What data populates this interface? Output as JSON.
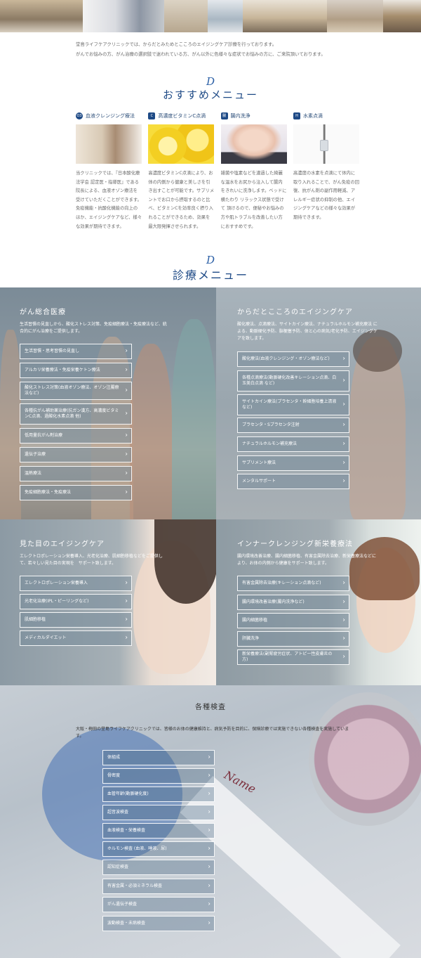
{
  "intro": {
    "line1": "堂島ライフケアクリニックでは、からだとみためとこころのエイジングケア診療を行っております。",
    "line2": "がんでお悩みの方、がん治療の選択肢で迷われている方、がん以外に色様々な症状でお悩みの方に、ご来院頂いております。"
  },
  "recommend": {
    "logo": "D",
    "title": "おすすめメニュー",
    "items": [
      {
        "icon": "O3",
        "label": "血液クレンジング療法",
        "text": "当クリニックでは、『日本酸化療法学会 認定医・指導医』である院長による、血液オゾン療法を受けていただくことができます。免疫機能・抗酸化機能の向上のほか、エイジングケアなど、様々な効果が期待できます。"
      },
      {
        "icon": "C",
        "label": "高濃度ビタミンC点滴",
        "text": "高濃度ビタミンC点滴により、お体の内側から健康と美しさを引き出すことが可能です。サプリメントでお口から摂取するのと比べ、ビタミンCを効率良く摂り入れることができるため、効果を最大限発揮させられます。"
      },
      {
        "icon": "腸",
        "label": "腸内洗浄",
        "text": "雑菌や塩素などを濾過した綺麗な温水をお尻から注入して腸内をきれいに洗浄します。ベッドに横たわり リラックス状態で受けて 頂けるので、便秘やお悩みの方や肌トラブルを改善したい方におすすめです。"
      },
      {
        "icon": "H",
        "label": "水素点滴",
        "text": "高濃度の水素を点滴にて体内に取り入れることで、がん免疫の回復、抗がん剤の副作用軽減、アレルギー症状の抑制の他、エイジングケアなどの様々な効果が期待できます。"
      }
    ]
  },
  "clinic": {
    "logo": "D",
    "title": "診療メニュー"
  },
  "cancer": {
    "title": "がん総合医療",
    "desc": "生活習慣の見直しから、酸化ストレス対策、免疫細胞療法・免疫療法など、統合的にがん治療をご提供します。",
    "buttons": [
      "生活習慣・思考習慣の見直し",
      "アルカリ栄養療法・免疫栄養ケトン療法",
      "酸化ストレス対策(血液オゾン療法、オゾン注腸療法など)",
      "各種抗がん補助薬治療(抗ガン漢方、高濃度ビタミンC点滴、過酸化水素点滴 他)",
      "低用量抗がん剤治療",
      "遺伝子治療",
      "温熱療法",
      "免疫細胞療法・免疫療法"
    ]
  },
  "body_mind": {
    "title": "からだとこころのエイジングケア",
    "desc": "酸化療法、点滴療法、サイトカイン療法、ナチュラルホルモン補充療法 による、動脈硬化予防、脳梗塞予防、体と心の病気/老化予防、エイジングケアを致します。",
    "buttons": [
      "酸化療法(血液クレンジング・オゾン療法など)",
      "各種点滴療法(動脈硬化改善キレーション点滴、白玉美白点滴 など)",
      "サイトカイン療法(プラセンタ・幹細胞培養上清液 など)",
      "プラセンタ・Sプラセンタ注射",
      "ナチュラルホルモン補充療法",
      "サプリメント療法",
      "メンタルサポート"
    ]
  },
  "looks": {
    "title": "見た目のエイジングケア",
    "desc": "エレクトロポレーション栄養導入、光老化治療、肌細胞移植などをご提供して、若々しい見た目の実現を　サポート致します。",
    "buttons": [
      "エレクトロポレーション栄養導入",
      "光老化治療(IPL・ピーリングなど)",
      "肌細胞移植",
      "メディカルダイエット"
    ]
  },
  "inner": {
    "title": "インナークレンジング新栄養療法",
    "desc": "腸内環境改善治療、腸内細菌移植、有害金属除去治療、新栄養療法などにより、お体の内側から健康をサポート致します。",
    "buttons": [
      "有害金属除去治療(キレーション点滴など)",
      "腸内環境改善治療(腸内洗浄など)",
      "腸内細菌移植",
      "肝臓洗浄",
      "新栄養療法(副腎疲労症状、アトピー性皮膚炎の方)"
    ]
  },
  "tests": {
    "title": "各種検査",
    "desc": "大阪・梅田の堂島ライフケアクリニックでは、皆様のお体の健康維持と、病気予防を目的に、保険診療では実施できない各種検査を実施しています。",
    "buttons": [
      "体組成",
      "骨密度",
      "血管年齢(動脈硬化度)",
      "超音波検査",
      "血液検査・栄養検査",
      "ホルモン検査 (血液、唾液、尿)",
      "認知症検査",
      "有害金属・必須ミネラル検査",
      "がん遺伝子検査",
      "波動検査・未病検査"
    ],
    "tube_label": "Name"
  }
}
